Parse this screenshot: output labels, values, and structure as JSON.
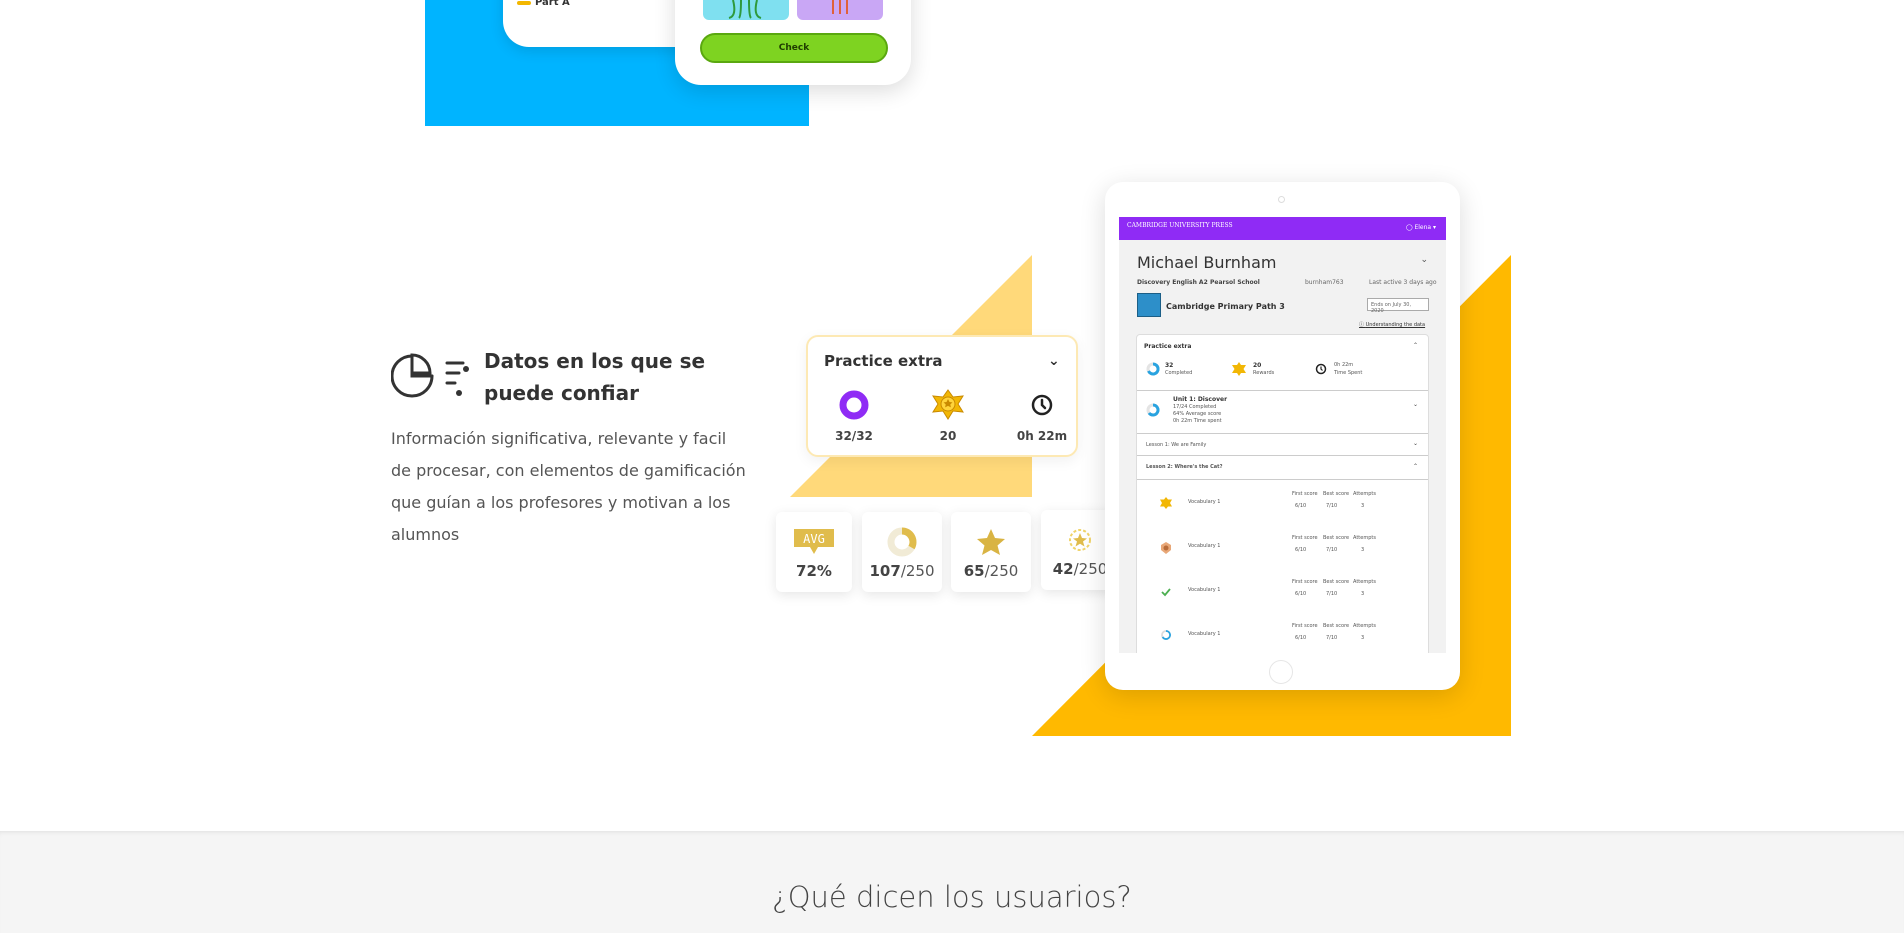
{
  "top_illustration": {
    "part_label": "Part A",
    "check_button": "Check"
  },
  "feature": {
    "icon": "chart-filter-icon",
    "title": "Datos en los que se puede confiar",
    "description": "Información significativa, relevante y facil de procesar, con elementos de gamificación que guían a los profesores y motivan a los alumnos"
  },
  "practice_card": {
    "title": "Practice extra",
    "stats": [
      {
        "icon": "completion-ring-icon",
        "label": "32/32"
      },
      {
        "icon": "medal-icon",
        "label": "20"
      },
      {
        "icon": "clock-icon",
        "label": "0h 22m"
      }
    ]
  },
  "score_cards": [
    {
      "icon": "avg-badge-icon",
      "badge_text": "AVG",
      "value": "72%",
      "bold": "72%",
      "rest": ""
    },
    {
      "icon": "progress-donut-icon",
      "value": "107/250",
      "bold": "107",
      "rest": "/250"
    },
    {
      "icon": "star-icon",
      "value": "65/250",
      "bold": "65",
      "rest": "/250"
    },
    {
      "icon": "star-badge-icon",
      "value": "42/250",
      "bold": "42",
      "rest": "/250"
    }
  ],
  "tablet": {
    "brand": "CAMBRIDGE UNIVERSITY PRESS",
    "user": "Elena",
    "student_name": "Michael Burnham",
    "meta": [
      "Discovery English A2",
      "Pearsol School",
      "burnham763",
      "Last active 3 days ago"
    ],
    "course": "Cambridge Primary Path 3",
    "ends": "Ends on July 30, 2020",
    "understand": "Understanding the data",
    "practice": {
      "title": "Practice extra",
      "completed_value": "32",
      "completed_label": "Completed",
      "rewards_value": "20",
      "rewards_label": "Rewards",
      "time_value": "0h 22m",
      "time_label": "Time Spent"
    },
    "unit": {
      "title": "Unit 1: Discover",
      "line1": "17/24 Completed",
      "line2": "64% Average score",
      "line3": "0h 22m Time spent"
    },
    "lesson1": "Lesson 1: We are Family",
    "lesson2": "Lesson 2: Where's the Cat?",
    "col_headers": [
      "First score",
      "Best score",
      "Attempts"
    ],
    "activities": [
      {
        "icon": "medal-icon",
        "name": "Vocabulary 1",
        "first": "6/10",
        "best": "7/10",
        "attempts": "3"
      },
      {
        "icon": "badge-icon",
        "name": "Vocabulary 1",
        "first": "6/10",
        "best": "7/10",
        "attempts": "3"
      },
      {
        "icon": "check-icon",
        "name": "Vocabulary 1",
        "first": "6/10",
        "best": "7/10",
        "attempts": "3"
      },
      {
        "icon": "progress-icon",
        "name": "Vocabulary 1",
        "first": "6/10",
        "best": "7/10",
        "attempts": "3"
      }
    ]
  },
  "bottom": {
    "title": "¿Qué dicen los usuarios?"
  },
  "colors": {
    "blue": "#00b4ff",
    "yellow": "#ffb900",
    "light_yellow": "#ffd97a",
    "purple": "#8f2bf5",
    "green": "#7ed321"
  }
}
